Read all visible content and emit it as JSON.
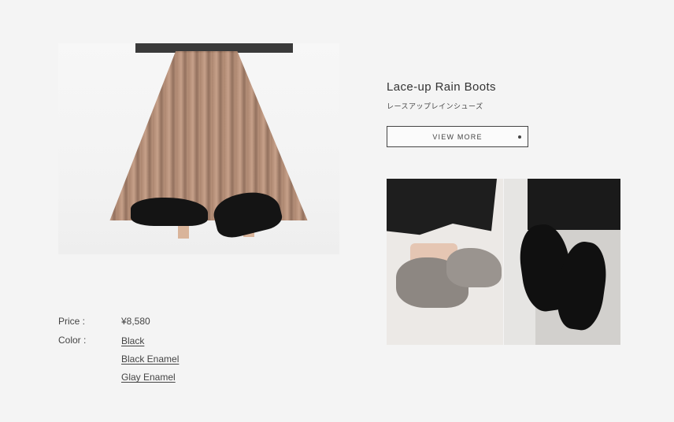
{
  "product": {
    "title": "Lace-up Rain Boots",
    "subtitle_ja": "レースアップレインシューズ",
    "view_more_label": "VIEW MORE"
  },
  "specs": {
    "price_label": "Price :",
    "price_value": "¥8,580",
    "color_label": "Color :",
    "colors": [
      "Black",
      "Black Enamel",
      "Glay Enamel"
    ]
  },
  "images": {
    "main": "photo-pleated-skirt-black-enamel-shoes",
    "detail_1": "photo-gray-enamel-shoes",
    "detail_2": "photo-black-shoes"
  }
}
